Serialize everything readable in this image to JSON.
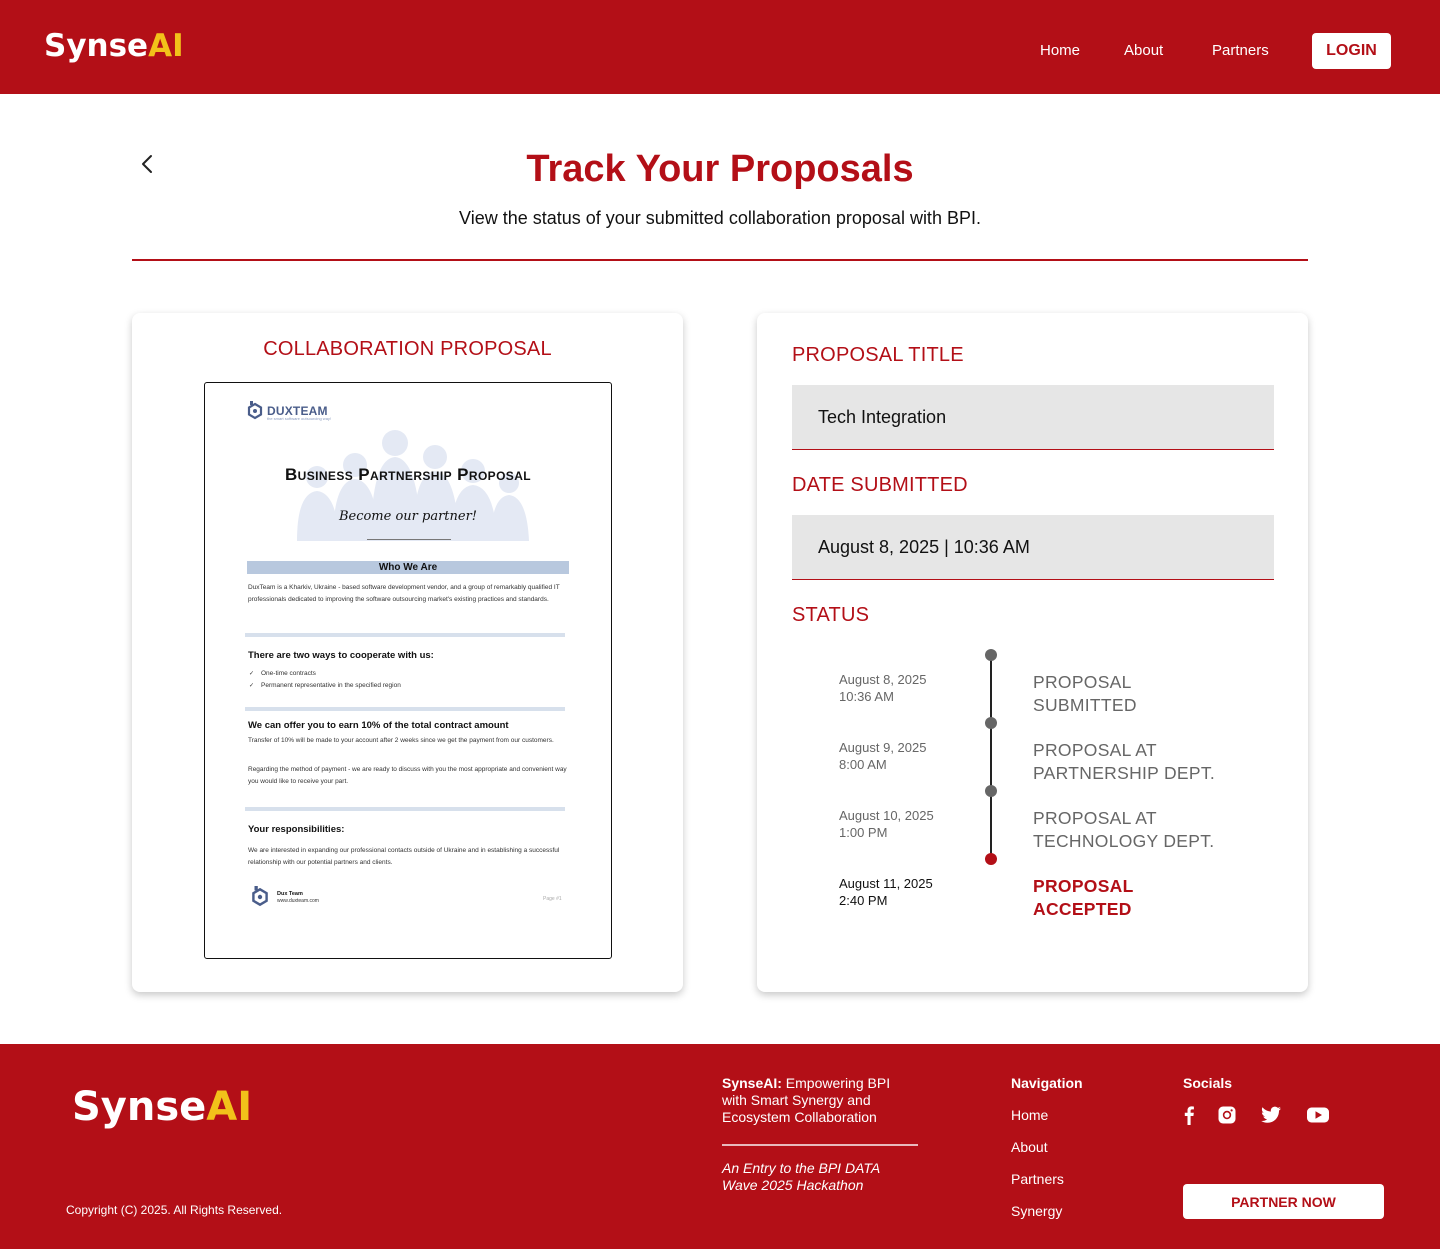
{
  "header": {
    "logo_main": "Synse",
    "logo_accent": "AI",
    "nav": [
      "Home",
      "About",
      "Partners"
    ],
    "login_label": "LOGIN"
  },
  "page": {
    "title": "Track Your Proposals",
    "subtitle": "View the status of your submitted collaboration proposal with BPI."
  },
  "proposal_card": {
    "heading": "COLLABORATION PROPOSAL",
    "document": {
      "logo_text": "DUXTEAM",
      "logo_tagline": "the smart software outsourcing way!",
      "title": "Business Partnership Proposal",
      "tagline": "Become our partner!",
      "section_band": "Who We Are",
      "intro": "DuxTeam is a Kharkiv, Ukraine - based software development vendor, and a group of remarkably qualified IT professionals dedicated to improving the software outsourcing market's existing practices and standards.",
      "ways_heading": "There are two ways to cooperate with us:",
      "ways": [
        "One-time contracts",
        "Permanent representative in the specified region"
      ],
      "earn_heading": "We can offer you to earn 10% of the total contract amount",
      "earn_p1": "Transfer of 10% will be made to your account after 2 weeks since we get the payment from our customers.",
      "earn_p2": "Regarding the method of payment - we are ready to discuss with you the most appropriate and convenient way  you would like to receive your part.",
      "resp_heading": "Your responsibilities:",
      "resp_p": "We are interested in expanding our professional contacts outside of Ukraine and in establishing a successful relationship with our potential partners and clients.",
      "footer_name": "Dux Team",
      "footer_url": "www.duxteam.com",
      "page_label": "Page #1"
    }
  },
  "details_card": {
    "title_label": "PROPOSAL TITLE",
    "title_value": "Tech Integration",
    "date_label": "DATE SUBMITTED",
    "date_value": "August 8, 2025 | 10:36 AM",
    "status_label": "STATUS",
    "timeline": [
      {
        "date": "August 8, 2025",
        "time": "10:36 AM",
        "line1": "PROPOSAL",
        "line2": "SUBMITTED",
        "active": false
      },
      {
        "date": "August 9, 2025",
        "time": "8:00 AM",
        "line1": "PROPOSAL AT",
        "line2": "PARTNERSHIP DEPT.",
        "active": false
      },
      {
        "date": "August 10, 2025",
        "time": "1:00 PM",
        "line1": "PROPOSAL AT",
        "line2": "TECHNOLOGY DEPT.",
        "active": false
      },
      {
        "date": "August 11, 2025",
        "time": "2:40 PM",
        "line1": "PROPOSAL",
        "line2": "ACCEPTED",
        "active": true
      }
    ]
  },
  "footer": {
    "logo_main": "Synse",
    "logo_accent": "AI",
    "copyright": "Copyright (C) 2025. All Rights Reserved.",
    "tagline_bold": "SynseAI:",
    "tagline_rest": " Empowering BPI with Smart Synergy and Ecosystem Collaboration",
    "hackathon": "An Entry to the BPI DATA Wave 2025 Hackathon",
    "nav_heading": "Navigation",
    "nav_links": [
      "Home",
      "About",
      "Partners",
      "Synergy"
    ],
    "socials_heading": "Socials",
    "socials": [
      "facebook-icon",
      "instagram-icon",
      "twitter-icon",
      "youtube-icon"
    ],
    "partner_label": "PARTNER NOW"
  },
  "colors": {
    "brand_red": "#b30f17",
    "accent_yellow": "#f2c11a",
    "field_bg": "#e6e6e6"
  }
}
